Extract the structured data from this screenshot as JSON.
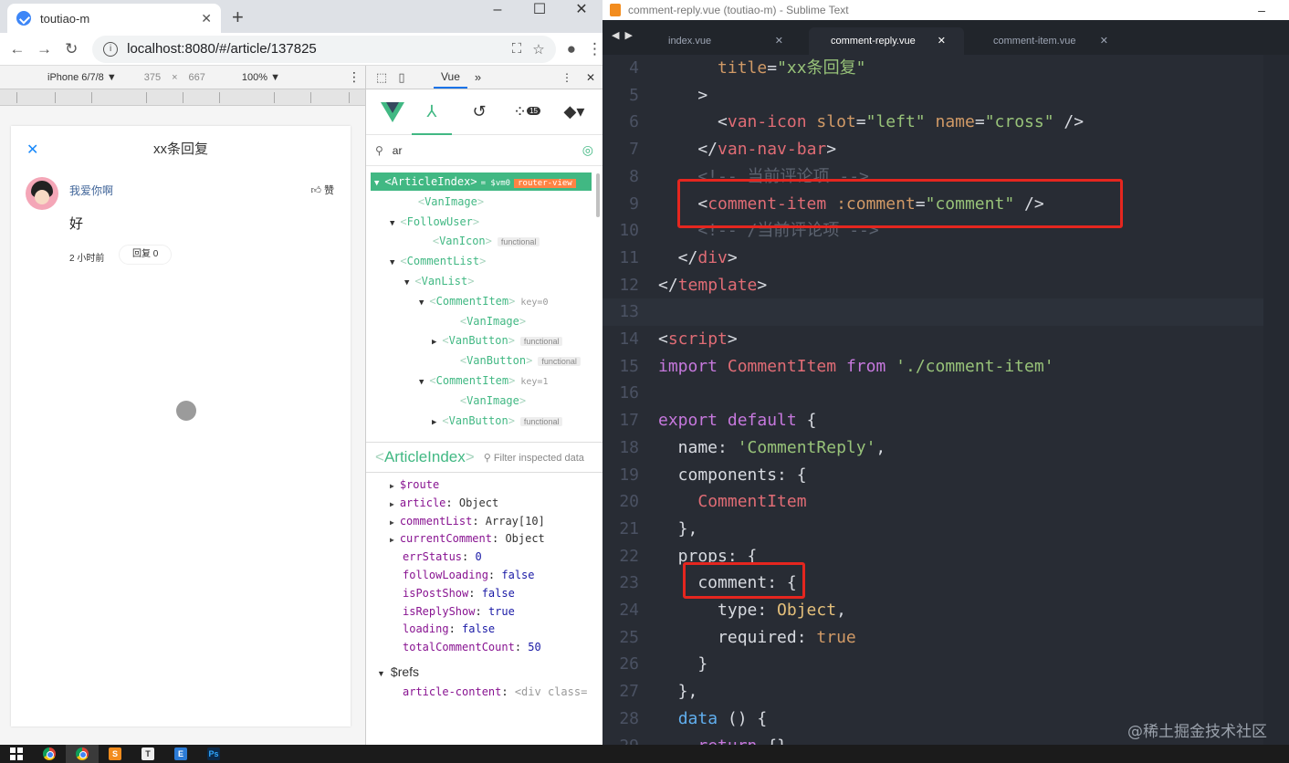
{
  "browser": {
    "tab_title": "toutiao-m",
    "tab_close": "✕",
    "new_tab": "+",
    "window_controls": [
      "–",
      "☐",
      "✕"
    ],
    "url": "localhost:8080/#/article/137825",
    "nav": {
      "back": "←",
      "forward": "→",
      "reload": "↻"
    }
  },
  "device_toolbar": {
    "device": "iPhone 6/7/8 ▼",
    "width": "375",
    "x": "×",
    "height": "667",
    "zoom": "100% ▼",
    "more": "⋮"
  },
  "page": {
    "close": "✕",
    "title": "xx条回复",
    "comment": {
      "username": "我爱你啊",
      "like_count": "赞",
      "content": "好",
      "time": "2 小时前",
      "reply_button": "回复 0"
    }
  },
  "devtools": {
    "active_tab": "Vue",
    "more_tabs": "»",
    "search_value": "ar",
    "tree": [
      {
        "tag": "ArticleIndex",
        "toggle": "▼",
        "selected": true,
        "vm": "= $vm0",
        "badge": "router-view"
      },
      {
        "tag": "VanImage",
        "toggle": ""
      },
      {
        "tag": "FollowUser",
        "toggle": "▼"
      },
      {
        "tag": "VanIcon",
        "toggle": "",
        "badge": "functional"
      },
      {
        "tag": "CommentList",
        "toggle": "▼"
      },
      {
        "tag": "VanList",
        "toggle": "▼"
      },
      {
        "tag": "CommentItem",
        "toggle": "▼",
        "key": "key=0"
      },
      {
        "tag": "VanImage",
        "toggle": ""
      },
      {
        "tag": "VanButton",
        "toggle": "▶",
        "badge": "functional"
      },
      {
        "tag": "VanButton",
        "toggle": "",
        "badge": "functional"
      },
      {
        "tag": "CommentItem",
        "toggle": "▼",
        "key": "key=1"
      },
      {
        "tag": "VanImage",
        "toggle": ""
      },
      {
        "tag": "VanButton",
        "toggle": "▶",
        "badge": "functional"
      }
    ],
    "inspected": {
      "name": "ArticleIndex",
      "filter_placeholder": "Filter inspected data",
      "props": [
        {
          "toggle": "▶",
          "key": "$route",
          "value": "",
          "kind": "plain"
        },
        {
          "toggle": "▶",
          "key": "article",
          "value": "Object",
          "kind": "plain"
        },
        {
          "toggle": "▶",
          "key": "commentList",
          "value": "Array[10]",
          "kind": "plain"
        },
        {
          "toggle": "▶",
          "key": "currentComment",
          "value": "Object",
          "kind": "plain"
        },
        {
          "toggle": "",
          "key": "errStatus",
          "value": "0",
          "kind": "num"
        },
        {
          "toggle": "",
          "key": "followLoading",
          "value": "false",
          "kind": "bool"
        },
        {
          "toggle": "",
          "key": "isPostShow",
          "value": "false",
          "kind": "bool"
        },
        {
          "toggle": "",
          "key": "isReplyShow",
          "value": "true",
          "kind": "bool"
        },
        {
          "toggle": "",
          "key": "loading",
          "value": "false",
          "kind": "bool"
        },
        {
          "toggle": "",
          "key": "totalCommentCount",
          "value": "50",
          "kind": "num"
        }
      ],
      "refs_label": "$refs",
      "refs": [
        {
          "key": "article-content",
          "value": "<div class="
        }
      ]
    }
  },
  "sublime": {
    "window_title": "comment-reply.vue (toutiao-m) - Sublime Text",
    "tabs": [
      {
        "label": "index.vue",
        "active": false
      },
      {
        "label": "comment-reply.vue",
        "active": true
      },
      {
        "label": "comment-item.vue",
        "active": false
      }
    ],
    "lines": [
      {
        "n": "4",
        "tokens": [
          [
            "plain",
            "      "
          ],
          [
            "attr",
            "title"
          ],
          [
            "plain",
            "="
          ],
          [
            "str",
            "\"xx条回复\""
          ]
        ]
      },
      {
        "n": "5",
        "tokens": [
          [
            "plain",
            "    >"
          ]
        ]
      },
      {
        "n": "6",
        "tokens": [
          [
            "plain",
            "      <"
          ],
          [
            "tag",
            "van-icon"
          ],
          [
            "plain",
            " "
          ],
          [
            "attr",
            "slot"
          ],
          [
            "plain",
            "="
          ],
          [
            "str",
            "\"left\""
          ],
          [
            "plain",
            " "
          ],
          [
            "attr",
            "name"
          ],
          [
            "plain",
            "="
          ],
          [
            "str",
            "\"cross\""
          ],
          [
            "plain",
            " />"
          ]
        ]
      },
      {
        "n": "7",
        "tokens": [
          [
            "plain",
            "    </"
          ],
          [
            "tag",
            "van-nav-bar"
          ],
          [
            "plain",
            ">"
          ]
        ]
      },
      {
        "n": "8",
        "tokens": [
          [
            "com",
            "    <!-- 当前评论项 -->"
          ]
        ]
      },
      {
        "n": "9",
        "tokens": [
          [
            "plain",
            "    <"
          ],
          [
            "tag",
            "comment-item"
          ],
          [
            "plain",
            " "
          ],
          [
            "attr",
            ":comment"
          ],
          [
            "plain",
            "="
          ],
          [
            "str",
            "\"comment\""
          ],
          [
            "plain",
            " />"
          ]
        ]
      },
      {
        "n": "10",
        "tokens": [
          [
            "com",
            "    <!-- /当前评论项 -->"
          ]
        ]
      },
      {
        "n": "11",
        "tokens": [
          [
            "plain",
            "  </"
          ],
          [
            "tag",
            "div"
          ],
          [
            "plain",
            ">"
          ]
        ]
      },
      {
        "n": "12",
        "tokens": [
          [
            "plain",
            "</"
          ],
          [
            "tag",
            "template"
          ],
          [
            "plain",
            ">"
          ]
        ]
      },
      {
        "n": "13",
        "tokens": [
          [
            "plain",
            ""
          ]
        ],
        "current": true
      },
      {
        "n": "14",
        "tokens": [
          [
            "plain",
            "<"
          ],
          [
            "tag",
            "script"
          ],
          [
            "plain",
            ">"
          ]
        ]
      },
      {
        "n": "15",
        "tokens": [
          [
            "kw",
            "import"
          ],
          [
            "plain",
            " "
          ],
          [
            "cls",
            "CommentItem"
          ],
          [
            "plain",
            " "
          ],
          [
            "kw",
            "from"
          ],
          [
            "plain",
            " "
          ],
          [
            "str",
            "'./comment-item'"
          ]
        ]
      },
      {
        "n": "16",
        "tokens": [
          [
            "plain",
            ""
          ]
        ]
      },
      {
        "n": "17",
        "tokens": [
          [
            "kw",
            "export"
          ],
          [
            "plain",
            " "
          ],
          [
            "kw",
            "default"
          ],
          [
            "plain",
            " {"
          ]
        ]
      },
      {
        "n": "18",
        "tokens": [
          [
            "plain",
            "  name: "
          ],
          [
            "str",
            "'CommentReply'"
          ],
          [
            "plain",
            ","
          ]
        ]
      },
      {
        "n": "19",
        "tokens": [
          [
            "plain",
            "  components: {"
          ]
        ]
      },
      {
        "n": "20",
        "tokens": [
          [
            "plain",
            "    "
          ],
          [
            "cls",
            "CommentItem"
          ]
        ]
      },
      {
        "n": "21",
        "tokens": [
          [
            "plain",
            "  },"
          ]
        ]
      },
      {
        "n": "22",
        "tokens": [
          [
            "plain",
            "  props: {"
          ]
        ]
      },
      {
        "n": "23",
        "tokens": [
          [
            "plain",
            "    comment: {"
          ]
        ]
      },
      {
        "n": "24",
        "tokens": [
          [
            "plain",
            "      type: "
          ],
          [
            "type",
            "Object"
          ],
          [
            "plain",
            ","
          ]
        ]
      },
      {
        "n": "25",
        "tokens": [
          [
            "plain",
            "      required: "
          ],
          [
            "bool",
            "true"
          ]
        ]
      },
      {
        "n": "26",
        "tokens": [
          [
            "plain",
            "    }"
          ]
        ]
      },
      {
        "n": "27",
        "tokens": [
          [
            "plain",
            "  },"
          ]
        ]
      },
      {
        "n": "28",
        "tokens": [
          [
            "plain",
            "  "
          ],
          [
            "fn",
            "data"
          ],
          [
            "plain",
            " () {"
          ]
        ]
      },
      {
        "n": "29",
        "tokens": [
          [
            "plain",
            "    "
          ],
          [
            "kw",
            "return"
          ],
          [
            "plain",
            " {}"
          ]
        ]
      }
    ],
    "watermark": "@稀土掘金技术社区"
  },
  "taskbar": {
    "items": [
      "start",
      "chrome",
      "chrome-active",
      "sublime",
      "typora",
      "editor",
      "photoshop"
    ],
    "labels": {
      "typora": "T",
      "editor": "E",
      "photoshop": "Ps"
    }
  }
}
